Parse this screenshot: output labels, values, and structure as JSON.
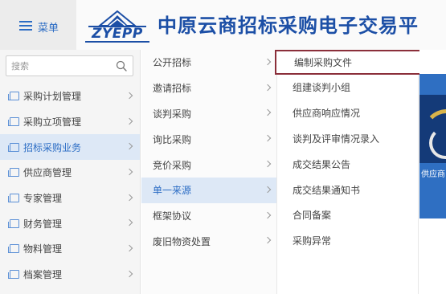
{
  "header": {
    "menu_label": "菜单",
    "logo_text": "ZYEPP",
    "site_title": "中原云商招标采购电子交易平"
  },
  "search": {
    "placeholder": "搜索"
  },
  "sidebar": {
    "items": [
      {
        "label": "采购计划管理",
        "active": false
      },
      {
        "label": "采购立项管理",
        "active": false
      },
      {
        "label": "招标采购业务",
        "active": true
      },
      {
        "label": "供应商管理",
        "active": false
      },
      {
        "label": "专家管理",
        "active": false
      },
      {
        "label": "财务管理",
        "active": false
      },
      {
        "label": "物料管理",
        "active": false
      },
      {
        "label": "档案管理",
        "active": false
      }
    ]
  },
  "submenu": {
    "items": [
      {
        "label": "公开招标",
        "active": false
      },
      {
        "label": "邀请招标",
        "active": false
      },
      {
        "label": "谈判采购",
        "active": false
      },
      {
        "label": "询比采购",
        "active": false
      },
      {
        "label": "竞价采购",
        "active": false
      },
      {
        "label": "单一来源",
        "active": true
      },
      {
        "label": "框架协议",
        "active": false
      },
      {
        "label": "废旧物资处置",
        "active": false
      }
    ]
  },
  "submenu3": {
    "items": [
      {
        "label": "编制采购文件",
        "highlight": true
      },
      {
        "label": "组建谈判小组",
        "highlight": false
      },
      {
        "label": "供应商响应情况",
        "highlight": false
      },
      {
        "label": "谈判及评审情况录入",
        "highlight": false
      },
      {
        "label": "成交结果公告",
        "highlight": false
      },
      {
        "label": "成交结果通知书",
        "highlight": false
      },
      {
        "label": "合同备案",
        "highlight": false
      },
      {
        "label": "采购异常",
        "highlight": false
      }
    ]
  },
  "right_peek": {
    "label": "供应商"
  },
  "colors": {
    "brand_blue": "#1c4fa6",
    "accent_blue": "#2b6cc4",
    "highlight_border": "#8b2f3a",
    "active_bg": "#dde8f6"
  },
  "icons": {
    "menu": "hamburger-icon",
    "search": "search-icon",
    "sidebar_item": "document-icon",
    "chevron": "chevron-right-icon"
  }
}
